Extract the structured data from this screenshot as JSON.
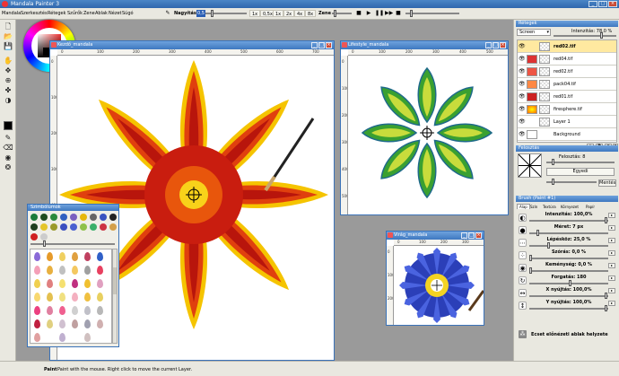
{
  "title": "Mandala Painter 3",
  "menu": [
    "Mandala",
    "Szerkesztés",
    "Rétegek",
    "Szűrők",
    "Zene",
    "Ablak",
    "Nézet",
    "Súgó"
  ],
  "toolbar": {
    "zoom_label": "Nagyítás",
    "zoom_value": "0,5",
    "zoom_buttons": [
      "1x",
      "2x",
      "3x",
      "4x",
      "8x"
    ],
    "zoom_half": "0,5x",
    "music_label": "Zene",
    "music_controls": [
      "stop-icon",
      "play-icon",
      "pause-icon",
      "step-icon",
      "record-icon"
    ]
  },
  "documents": [
    {
      "title": "Kezdő_mandala",
      "ruler_h": [
        "0",
        "100",
        "200",
        "300",
        "400",
        "500",
        "600",
        "700"
      ],
      "ruler_v": [
        "0",
        "100",
        "200",
        "300",
        "400",
        "500",
        "600",
        "700"
      ]
    },
    {
      "title": "Lifestyle_mandala",
      "ruler_h": [
        "0",
        "100",
        "200",
        "300",
        "400",
        "500"
      ],
      "ruler_v": [
        "0",
        "100",
        "200",
        "300",
        "400",
        "500"
      ]
    },
    {
      "title": "Virág_mandala",
      "ruler_h": [
        "0",
        "100",
        "200",
        "300"
      ],
      "ruler_v": [
        "0",
        "100",
        "200"
      ]
    }
  ],
  "shapes_panel": {
    "title": "Szimbólumok"
  },
  "layers": {
    "title": "Rétegek",
    "blend_mode": "Screen",
    "opacity_label": "Intenzitás: 78,0 %",
    "items": [
      {
        "name": "red02.tif",
        "selected": true
      },
      {
        "name": "red04.tif",
        "selected": false
      },
      {
        "name": "red02.tif",
        "selected": false
      },
      {
        "name": "pack04.tif",
        "selected": false
      },
      {
        "name": "red01.tif",
        "selected": false
      },
      {
        "name": "firesphere.tif",
        "selected": false
      },
      {
        "name": "Layer 1",
        "selected": false
      },
      {
        "name": "Background",
        "selected": false
      }
    ]
  },
  "symmetry": {
    "title": "Felosztás",
    "divisions_label": "Felosztás: 8",
    "equal_button": "Egyedi",
    "save_button": "Mentés"
  },
  "brush": {
    "title": "Brush (Paint #1)",
    "tabs": [
      "Alap",
      "Szín",
      "Textúra",
      "Környezet",
      "Papír"
    ],
    "params": [
      {
        "label": "Intenzitás: 100,0%",
        "value": 1.0
      },
      {
        "label": "Méret: 7 px",
        "value": 0.1
      },
      {
        "label": "Lépésköz: 25,0 %",
        "value": 0.25
      },
      {
        "label": "Szórás: 0,0 %",
        "value": 0.0
      },
      {
        "label": "Keménység: 0,0 %",
        "value": 0.0
      },
      {
        "label": "Forgatás: 180",
        "value": 0.5
      },
      {
        "label": "X nyújtás: 100,0%",
        "value": 1.0
      },
      {
        "label": "Y nyújtás: 100,0%",
        "value": 1.0
      }
    ],
    "preset_label": "Ecset előnézeti ablak helyzete"
  },
  "status": {
    "bold": "Paint",
    "text": "Paint with the mouse. Right click to move the current Layer."
  },
  "colors": {
    "accent": "#3e78c0",
    "flower_red": "#c81e10",
    "flower_yellow": "#f5c400",
    "green": "#4a9a2a",
    "blue": "#2b3fb8"
  }
}
